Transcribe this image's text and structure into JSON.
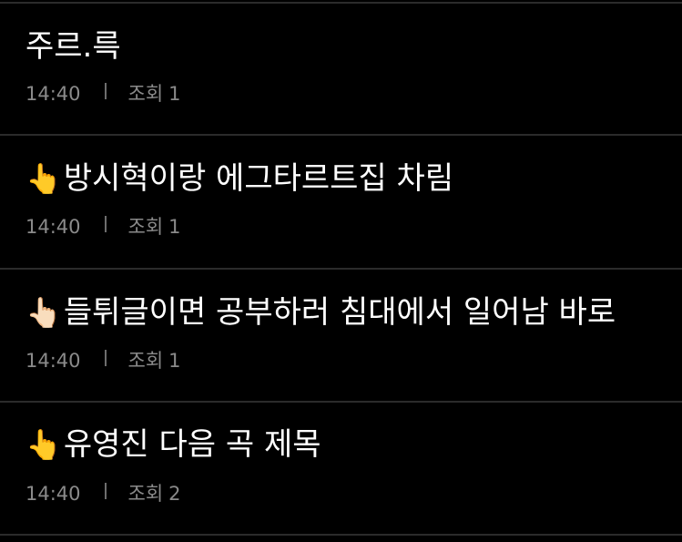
{
  "posts": [
    {
      "emoji": "",
      "title": "주르.륵",
      "time": "14:40",
      "views_label": "조회",
      "views": "1"
    },
    {
      "emoji": "👆",
      "title": "방시혁이랑 에그타르트집 차림",
      "time": "14:40",
      "views_label": "조회",
      "views": "1"
    },
    {
      "emoji": "👆🏻",
      "title": "들튀글이면 공부하러 침대에서 일어남 바로",
      "time": "14:40",
      "views_label": "조회",
      "views": "1"
    },
    {
      "emoji": "👆",
      "title": "유영진 다음 곡 제목",
      "time": "14:40",
      "views_label": "조회",
      "views": "2"
    }
  ]
}
